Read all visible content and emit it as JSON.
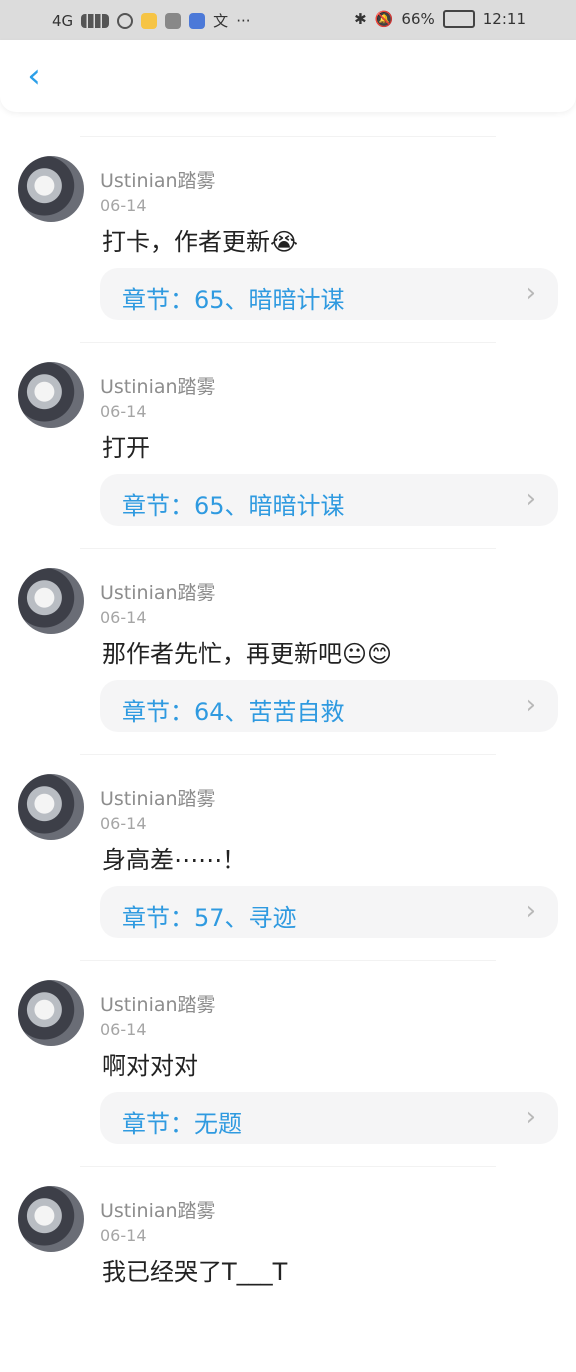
{
  "status": {
    "network": "4G",
    "battery": "66%",
    "time": "12:11",
    "text_icon": "文",
    "more": "···",
    "bluetooth_icon": "bluetooth-icon",
    "mute_icon": "bell-off-icon"
  },
  "topbar": {
    "back_icon": "chevron-left-icon"
  },
  "comments": [
    {
      "user": "Ustinian踏雾",
      "date": "06-14",
      "text": "打卡，作者更新😭",
      "chapter": "章节：65、暗暗计谋"
    },
    {
      "user": "Ustinian踏雾",
      "date": "06-14",
      "text": "打开",
      "chapter": "章节：65、暗暗计谋"
    },
    {
      "user": "Ustinian踏雾",
      "date": "06-14",
      "text": "那作者先忙，再更新吧😐😊",
      "chapter": "章节：64、苦苦自救"
    },
    {
      "user": "Ustinian踏雾",
      "date": "06-14",
      "text": "身高差⋯⋯！",
      "chapter": "章节：57、寻迹"
    },
    {
      "user": "Ustinian踏雾",
      "date": "06-14",
      "text": "啊对对对",
      "chapter": "章节：无题"
    },
    {
      "user": "Ustinian踏雾",
      "date": "06-14",
      "text": "我已经哭了T___T",
      "chapter": ""
    }
  ],
  "colors": {
    "accent": "#2f9ae0",
    "status_bg": "#dcdcdc",
    "card_bg": "#f5f5f6"
  }
}
